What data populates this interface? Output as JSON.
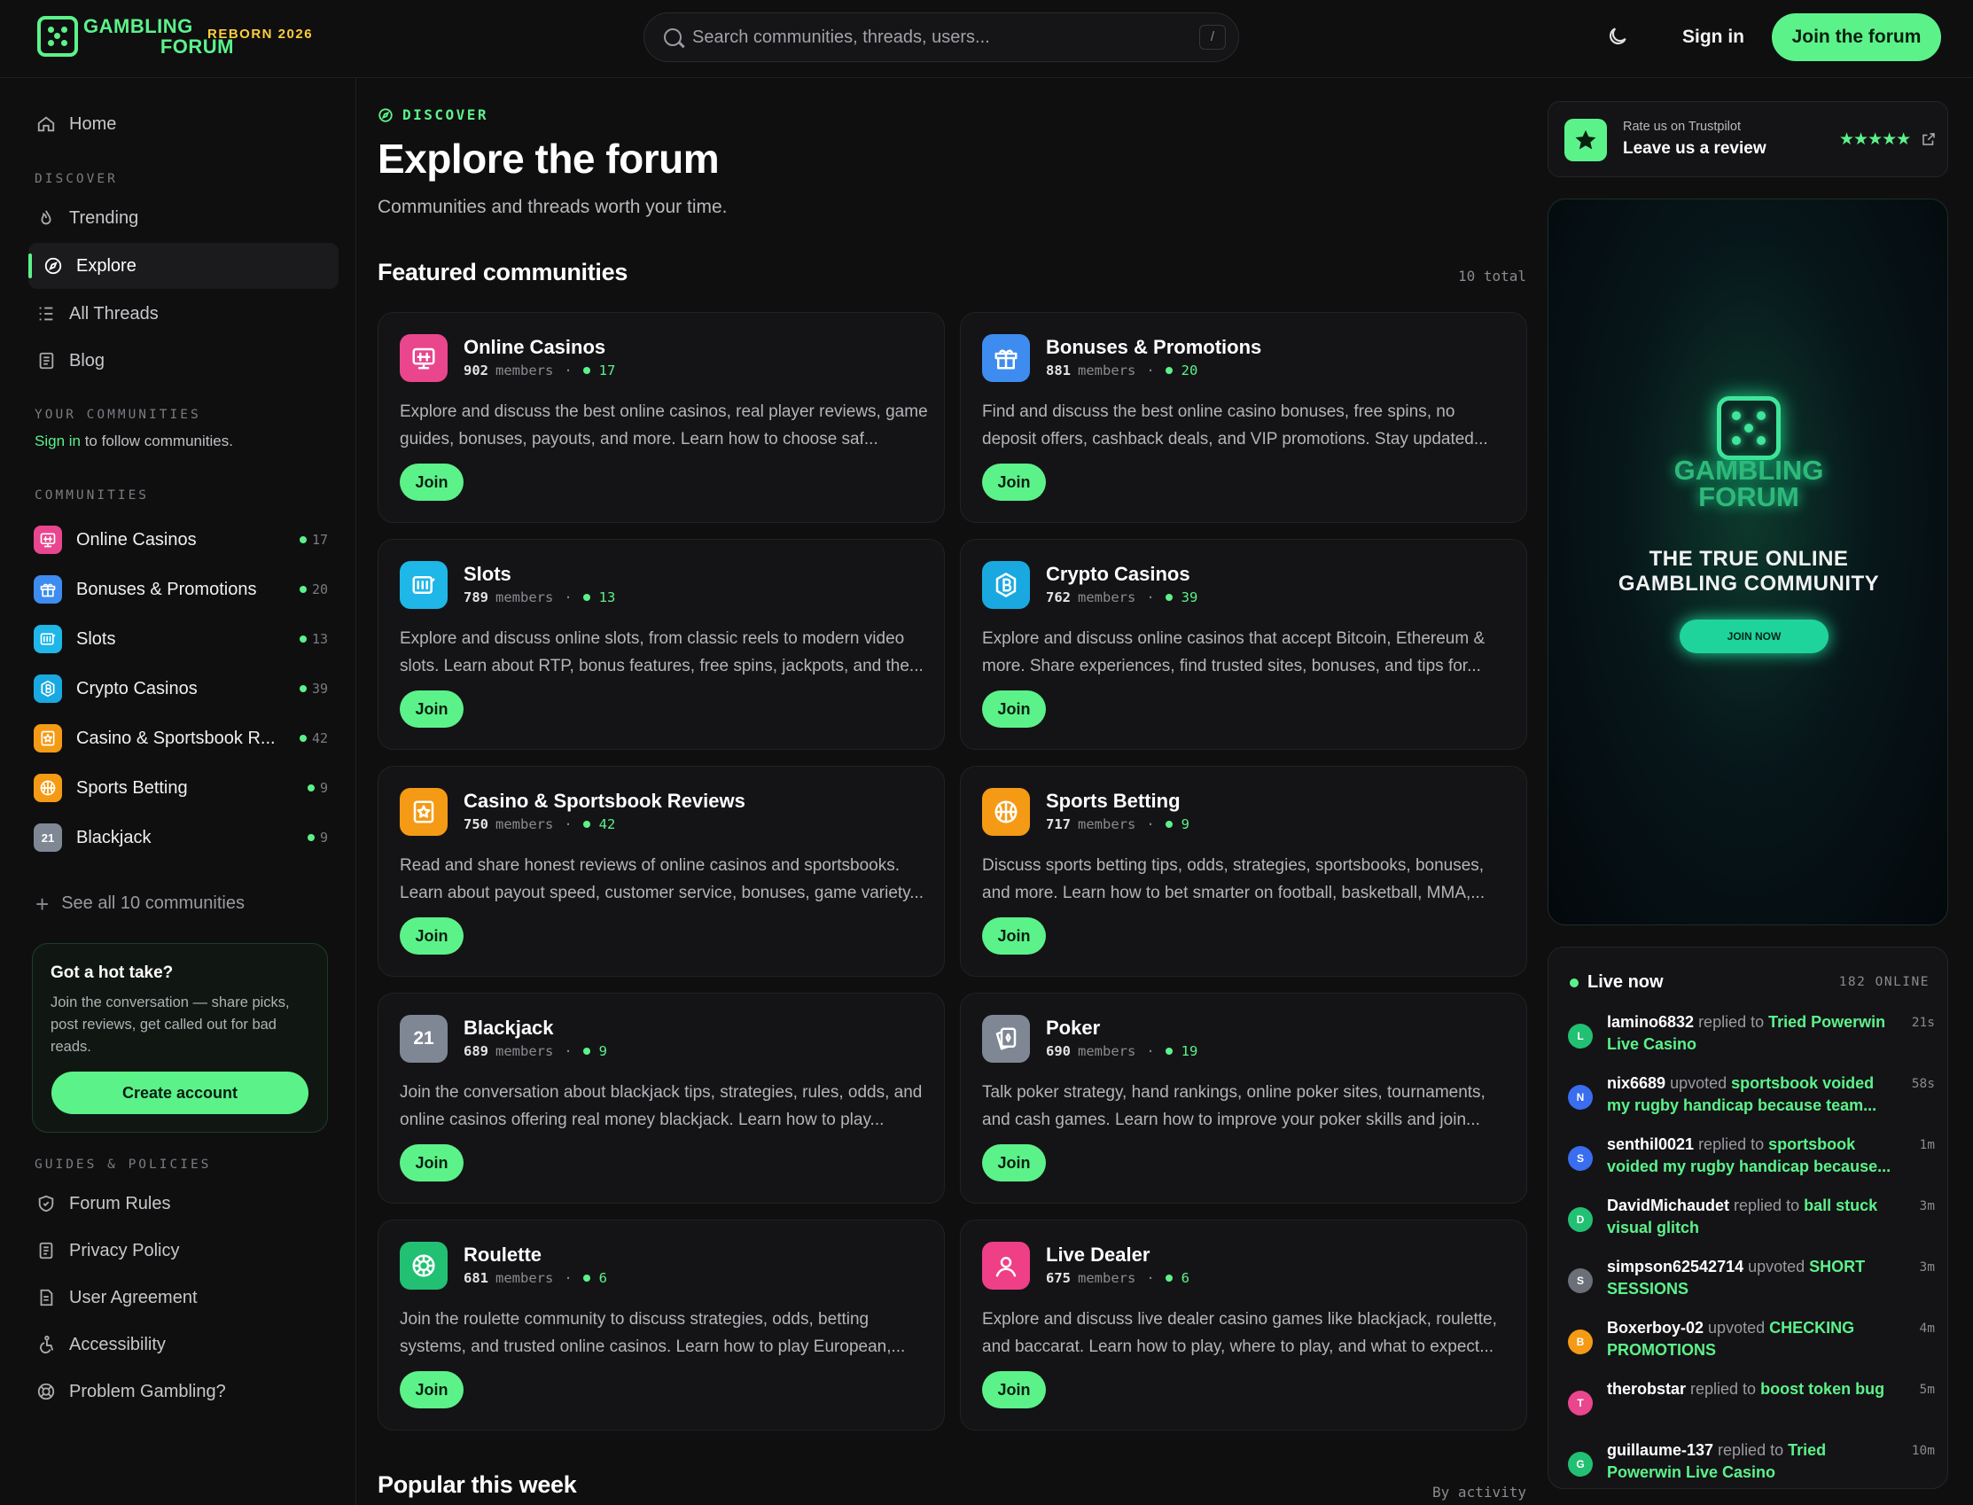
{
  "header": {
    "logo_line1": "GAMBLING",
    "logo_line2": "FORUM",
    "logo_tag": "REBORN 2026",
    "search_placeholder": "Search communities, threads, users...",
    "search_shortcut": "/",
    "sign_in": "Sign in",
    "join": "Join the forum"
  },
  "sidebar": {
    "home": "Home",
    "discover_label": "DISCOVER",
    "discover_items": [
      "Trending",
      "Explore",
      "All Threads",
      "Blog"
    ],
    "your_communities_label": "YOUR COMMUNITIES",
    "sign_in_link": "Sign in",
    "sign_in_note": " to follow communities.",
    "communities_label": "COMMUNITIES",
    "communities": [
      {
        "name": "Online Casinos",
        "online": "17",
        "color": "#e9468e",
        "icon": "monitor-icon"
      },
      {
        "name": "Bonuses & Promotions",
        "online": "20",
        "color": "#3e8cf0",
        "icon": "gift-icon"
      },
      {
        "name": "Slots",
        "online": "13",
        "color": "#1fb6e8",
        "icon": "slot-icon"
      },
      {
        "name": "Crypto Casinos",
        "online": "39",
        "color": "#19a9e0",
        "icon": "bitcoin-icon"
      },
      {
        "name": "Casino & Sportsbook R...",
        "online": "42",
        "color": "#f59a14",
        "icon": "star-icon"
      },
      {
        "name": "Sports Betting",
        "online": "9",
        "color": "#f59a14",
        "icon": "ball-icon"
      },
      {
        "name": "Blackjack",
        "online": "9",
        "color": "#7f8794",
        "icon": "21-icon",
        "badge": "21"
      }
    ],
    "see_all": "See all 10 communities",
    "hot_take": {
      "title": "Got a hot take?",
      "body": "Join the conversation — share picks, post reviews, get called out for bad reads.",
      "button": "Create account"
    },
    "guides_label": "GUIDES & POLICIES",
    "guides": [
      "Forum Rules",
      "Privacy Policy",
      "User Agreement",
      "Accessibility",
      "Problem Gambling?"
    ]
  },
  "main": {
    "eyebrow": "DISCOVER",
    "title": "Explore the forum",
    "subtitle": "Communities and threads worth your time.",
    "featured_title": "Featured communities",
    "featured_meta": "10 total",
    "members_label": "members",
    "join_label": "Join",
    "cards": [
      {
        "name": "Online Casinos",
        "members": "902",
        "online": "17",
        "color": "#e9468e",
        "icon": "monitor-icon",
        "desc": "Explore and discuss the best online casinos, real player reviews, game guides, bonuses, payouts, and more. Learn how to choose saf..."
      },
      {
        "name": "Bonuses & Promotions",
        "members": "881",
        "online": "20",
        "color": "#3e8cf0",
        "icon": "gift-icon",
        "desc": "Find and discuss the best online casino bonuses, free spins, no deposit offers, cashback deals, and VIP promotions. Stay updated..."
      },
      {
        "name": "Slots",
        "members": "789",
        "online": "13",
        "color": "#1fb6e8",
        "icon": "slot-icon",
        "desc": "Explore and discuss online slots, from classic reels to modern video slots. Learn about RTP, bonus features, free spins, jackpots, and the..."
      },
      {
        "name": "Crypto Casinos",
        "members": "762",
        "online": "39",
        "color": "#19a9e0",
        "icon": "bitcoin-icon",
        "desc": "Explore and discuss online casinos that accept Bitcoin, Ethereum & more. Share experiences, find trusted sites, bonuses, and tips for..."
      },
      {
        "name": "Casino & Sportsbook Reviews",
        "members": "750",
        "online": "42",
        "color": "#f59a14",
        "icon": "star-icon",
        "desc": "Read and share honest reviews of online casinos and sportsbooks. Learn about payout speed, customer service, bonuses, game variety..."
      },
      {
        "name": "Sports Betting",
        "members": "717",
        "online": "9",
        "color": "#f59a14",
        "icon": "ball-icon",
        "desc": "Discuss sports betting tips, odds, strategies, sportsbooks, bonuses, and more. Learn how to bet smarter on football, basketball, MMA,..."
      },
      {
        "name": "Blackjack",
        "members": "689",
        "online": "9",
        "color": "#7f8794",
        "icon": "21-icon",
        "badge": "21",
        "desc": "Join the conversation about blackjack tips, strategies, rules, odds, and online casinos offering real money blackjack. Learn how to play..."
      },
      {
        "name": "Poker",
        "members": "690",
        "online": "19",
        "color": "#7f8794",
        "icon": "cards-icon",
        "desc": "Talk poker strategy, hand rankings, online poker sites, tournaments, and cash games. Learn how to improve your poker skills and join..."
      },
      {
        "name": "Roulette",
        "members": "681",
        "online": "6",
        "color": "#22c073",
        "icon": "roulette-icon",
        "desc": "Join the roulette community to discuss strategies, odds, betting systems, and trusted online casinos. Learn how to play European,..."
      },
      {
        "name": "Live Dealer",
        "members": "675",
        "online": "6",
        "color": "#ef3f86",
        "icon": "person-icon",
        "desc": "Explore and discuss live dealer casino games like blackjack, roulette, and baccarat. Learn how to play, where to play, and what to expect..."
      }
    ],
    "popular_title": "Popular this week",
    "popular_meta": "By activity"
  },
  "right": {
    "trust_small": "Rate us on Trustpilot",
    "trust_big": "Leave us a review",
    "stars": "★★★★★",
    "ad": {
      "logo_line1": "GAMBLING",
      "logo_line2": "FORUM",
      "tagline_line1": "THE TRUE ONLINE",
      "tagline_line2": "GAMBLING COMMUNITY",
      "button": "JOIN NOW"
    },
    "live": {
      "title": "Live now",
      "count": "182 ONLINE",
      "activity": [
        {
          "initial": "L",
          "color": "#22c073",
          "user": "lamino6832",
          "action": " replied to ",
          "target": "Tried Powerwin Live Casino",
          "time": "21s"
        },
        {
          "initial": "N",
          "color": "#3a6df0",
          "user": "nix6689",
          "action": " upvoted ",
          "target": "sportsbook voided my rugby handicap because team...",
          "time": "58s"
        },
        {
          "initial": "S",
          "color": "#3a6df0",
          "user": "senthil0021",
          "action": " replied to ",
          "target": "sportsbook voided my rugby handicap because...",
          "time": "1m"
        },
        {
          "initial": "D",
          "color": "#22c073",
          "user": "DavidMichaudet",
          "action": " replied to ",
          "target": "ball stuck visual glitch",
          "time": "3m"
        },
        {
          "initial": "S",
          "color": "#6b6f78",
          "user": "simpson62542714",
          "action": " upvoted ",
          "target": "SHORT SESSIONS",
          "time": "3m"
        },
        {
          "initial": "B",
          "color": "#f59a14",
          "user": "Boxerboy-02",
          "action": " upvoted ",
          "target": "CHECKING PROMOTIONS",
          "time": "4m"
        },
        {
          "initial": "T",
          "color": "#e9468e",
          "user": "therobstar",
          "action": " replied to ",
          "target": "boost token bug",
          "time": "5m"
        },
        {
          "initial": "G",
          "color": "#22c073",
          "user": "guillaume-137",
          "action": " replied to ",
          "target": "Tried Powerwin Live Casino",
          "time": "10m"
        }
      ]
    }
  }
}
